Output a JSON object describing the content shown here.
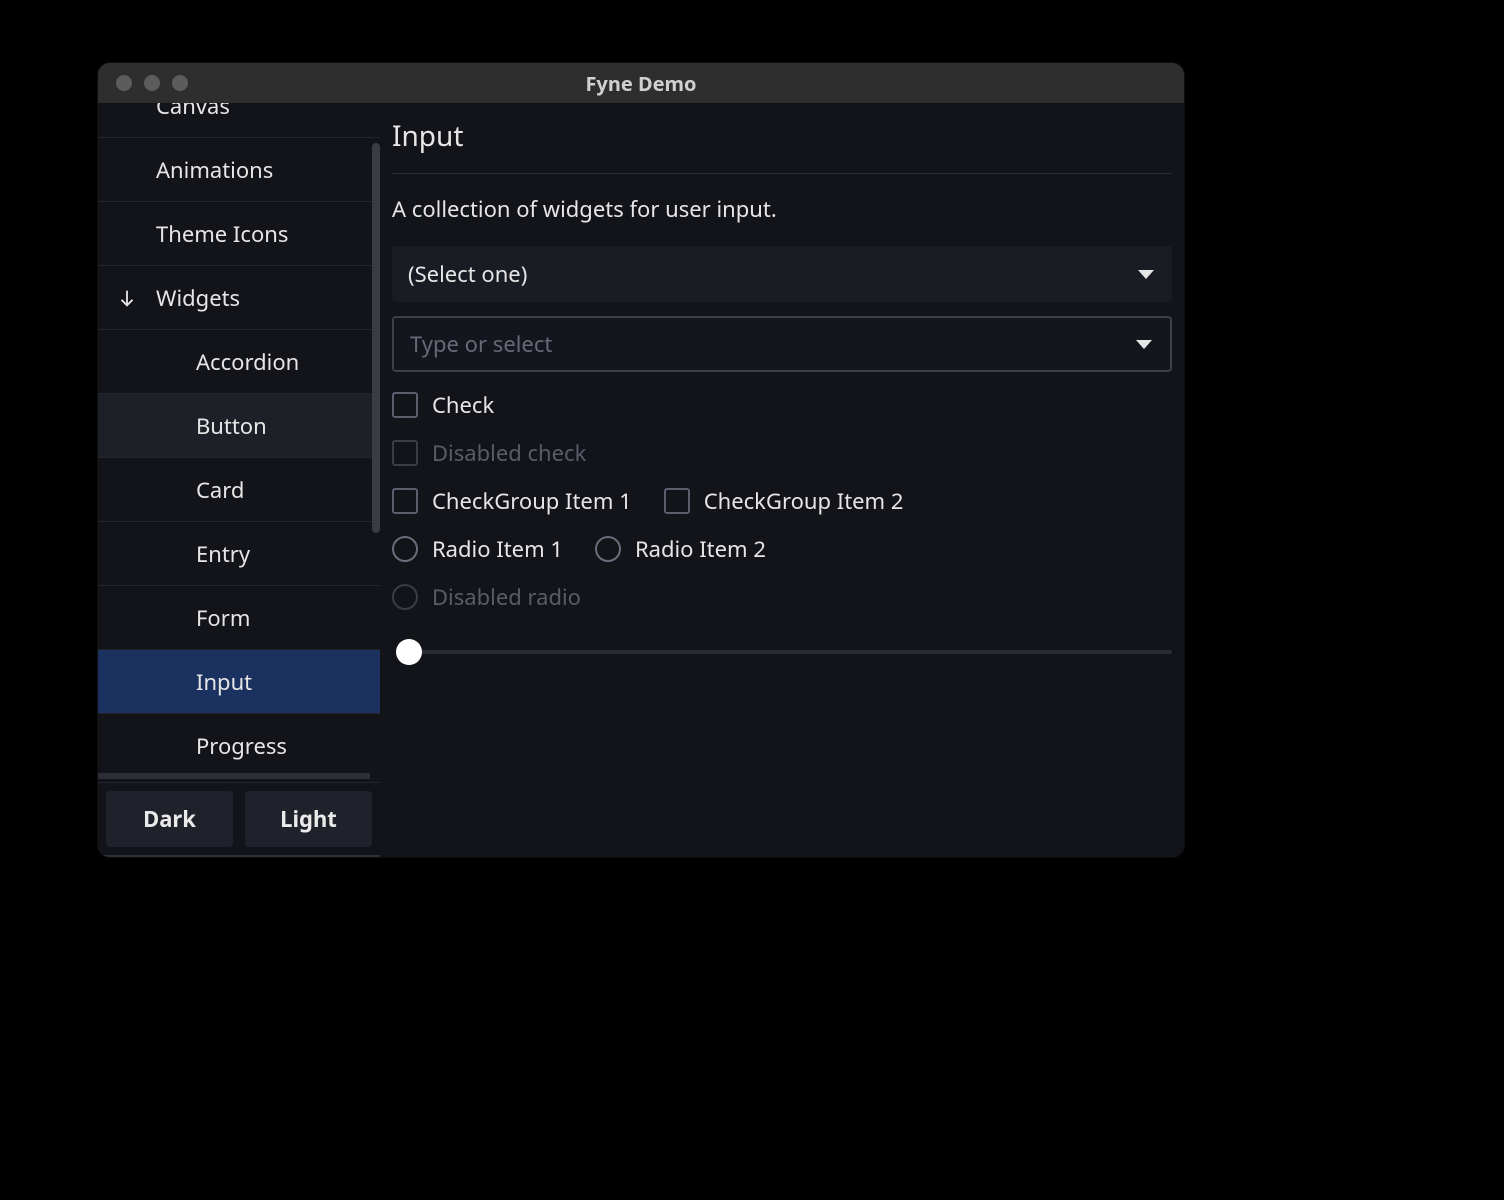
{
  "window": {
    "title": "Fyne Demo"
  },
  "sidebar": {
    "items": [
      {
        "label": "Canvas",
        "kind": "top"
      },
      {
        "label": "Animations",
        "kind": "top"
      },
      {
        "label": "Theme Icons",
        "kind": "top"
      },
      {
        "label": "Widgets",
        "kind": "expand"
      },
      {
        "label": "Accordion",
        "kind": "child"
      },
      {
        "label": "Button",
        "kind": "child",
        "hover": true
      },
      {
        "label": "Card",
        "kind": "child"
      },
      {
        "label": "Entry",
        "kind": "child"
      },
      {
        "label": "Form",
        "kind": "child"
      },
      {
        "label": "Input",
        "kind": "child",
        "selected": true
      },
      {
        "label": "Progress",
        "kind": "child"
      }
    ],
    "theme_buttons": {
      "dark": "Dark",
      "light": "Light"
    }
  },
  "main": {
    "heading": "Input",
    "description": "A collection of widgets for user input.",
    "select_placeholder": "(Select one)",
    "combo_placeholder": "Type or select",
    "check_label": "Check",
    "disabled_check_label": "Disabled check",
    "checkgroup": [
      "CheckGroup Item 1",
      "CheckGroup Item 2"
    ],
    "radios": [
      "Radio Item 1",
      "Radio Item 2"
    ],
    "disabled_radio_label": "Disabled radio"
  }
}
